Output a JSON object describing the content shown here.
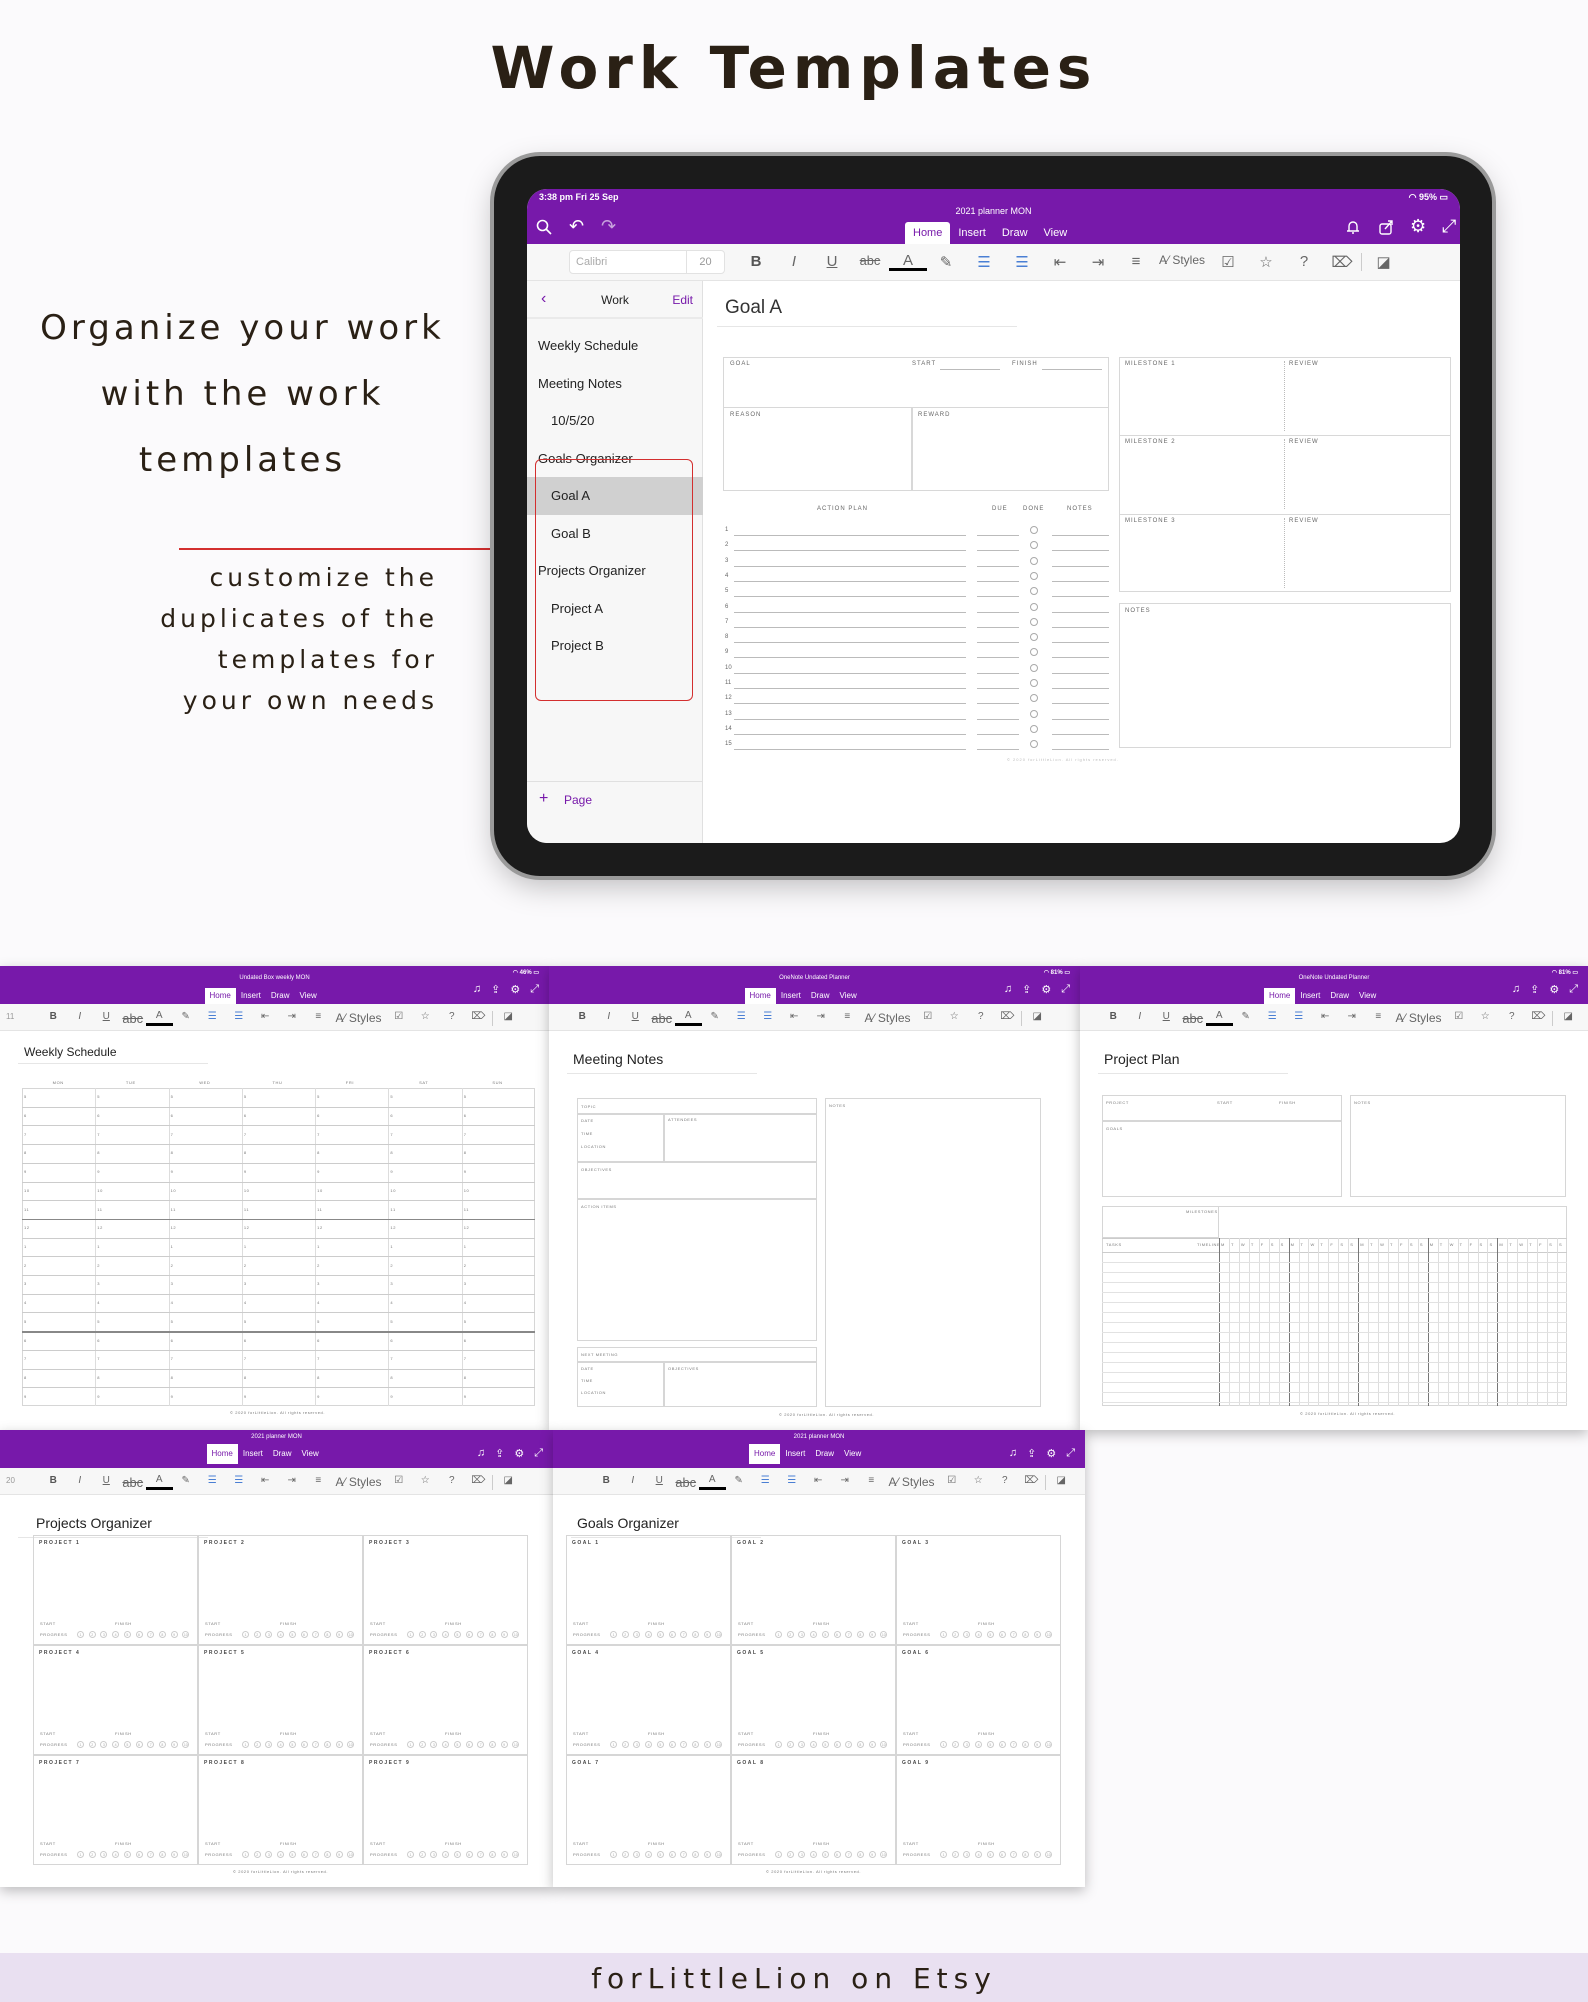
{
  "header": {
    "title": "Work Templates"
  },
  "tagline": {
    "lines": [
      "Organize your work",
      "with the work",
      "templates"
    ]
  },
  "note": {
    "lines": [
      "customize the",
      "duplicates of the",
      "templates for",
      "your own needs"
    ]
  },
  "footer": {
    "text": "forLittleLion on Etsy"
  },
  "colors": {
    "onenote_purple": "#7719aa",
    "highlight_red": "#d32f2f",
    "title_brown": "#2a2015",
    "footer_band": "#e9e0f1"
  },
  "toolbar_icons": [
    "bold",
    "italic",
    "underline",
    "strikethrough",
    "font-color",
    "highlighter",
    "bullets",
    "numbering",
    "outdent",
    "indent",
    "align",
    "styles",
    "checkbox",
    "star",
    "question",
    "tag",
    "sticky-note"
  ],
  "toolbar_glyphs": {
    "bold": "B",
    "italic": "I",
    "underline": "U",
    "strike": "abc",
    "font_color": "A",
    "styles": "Styles"
  },
  "tablet": {
    "status": {
      "time": "3:38 pm  Fri 25 Sep",
      "battery": "95%"
    },
    "notebook_title": "2021 planner MON",
    "tabs": [
      "Home",
      "Insert",
      "Draw",
      "View"
    ],
    "active_tab": "Home",
    "toolbar": {
      "font": "Calibri",
      "size": "20"
    },
    "sidebar": {
      "section": "Work",
      "edit": "Edit",
      "pages": [
        {
          "label": "Weekly Schedule",
          "sub": false,
          "selected": false
        },
        {
          "label": "Meeting Notes",
          "sub": false,
          "selected": false
        },
        {
          "label": "10/5/20",
          "sub": true,
          "selected": false
        },
        {
          "label": "Goals Organizer",
          "sub": false,
          "selected": false
        },
        {
          "label": "Goal A",
          "sub": true,
          "selected": true
        },
        {
          "label": "Goal B",
          "sub": true,
          "selected": false
        },
        {
          "label": "Projects Organizer",
          "sub": false,
          "selected": false
        },
        {
          "label": "Project A",
          "sub": true,
          "selected": false
        },
        {
          "label": "Project B",
          "sub": true,
          "selected": false
        }
      ],
      "add_page": "Page"
    },
    "page": {
      "title": "Goal A",
      "goal": "GOAL",
      "start": "START",
      "finish": "FINISH",
      "reason": "REASON",
      "reward": "REWARD",
      "action_plan": "ACTION PLAN",
      "due": "DUE",
      "done": "DONE",
      "notes": "NOTES",
      "rows": [
        "1",
        "2",
        "3",
        "4",
        "5",
        "6",
        "7",
        "8",
        "9",
        "10",
        "11",
        "12",
        "13",
        "14",
        "15"
      ],
      "milestones": [
        "MILESTONE 1",
        "MILESTONE 2",
        "MILESTONE 3"
      ],
      "review": "REVIEW",
      "notes_box": "NOTES",
      "copyright": "© 2020 forLittleLion. All rights reserved."
    }
  },
  "thumbnails": [
    {
      "type": "weekly",
      "notebook": "Undated Box weekly MON",
      "battery": "46%",
      "size": "11",
      "title": "Weekly Schedule",
      "days": [
        "MON",
        "TUE",
        "WED",
        "THU",
        "FRI",
        "SAT",
        "SUN"
      ],
      "hours": [
        "5",
        "6",
        "7",
        "8",
        "9",
        "10",
        "11",
        "12",
        "1",
        "2",
        "3",
        "4",
        "5",
        "6",
        "7",
        "8",
        "9"
      ]
    },
    {
      "type": "meeting",
      "notebook": "OneNote Undated Planner",
      "battery": "81%",
      "size": "",
      "title": "Meeting Notes",
      "labels": {
        "topic": "TOPIC",
        "date": "DATE",
        "time": "TIME",
        "location": "LOCATION",
        "attendees": "ATTENDEES",
        "objectives": "OBJECTIVES",
        "action_items": "ACTION ITEMS",
        "next_meeting": "NEXT MEETING",
        "notes": "NOTES"
      }
    },
    {
      "type": "project",
      "notebook": "OneNote Undated Planner",
      "battery": "81%",
      "size": "",
      "title": "Project Plan",
      "labels": {
        "project": "PROJECT",
        "start": "START",
        "finish": "FINISH",
        "notes": "NOTES",
        "goals": "GOALS",
        "milestones": "MILESTONES",
        "tasks": "TASKS",
        "timeline": "TIMELINE"
      },
      "weekdays": [
        "M",
        "T",
        "W",
        "T",
        "F",
        "S",
        "S"
      ],
      "weeks": 5
    },
    {
      "type": "organizer",
      "notebook": "2021 planner MON",
      "battery": "",
      "size": "20",
      "title": "Projects Organizer",
      "cards": [
        "PROJECT 1",
        "PROJECT 2",
        "PROJECT 3",
        "PROJECT 4",
        "PROJECT 5",
        "PROJECT 6",
        "PROJECT 7",
        "PROJECT 8",
        "PROJECT 9"
      ],
      "start": "START",
      "finish": "FINISH",
      "progress": "PROGRESS",
      "steps": [
        "1",
        "2",
        "3",
        "4",
        "5",
        "6",
        "7",
        "8",
        "9",
        "10"
      ]
    },
    {
      "type": "organizer",
      "notebook": "2021 planner MON",
      "battery": "",
      "size": "",
      "title": "Goals Organizer",
      "cards": [
        "GOAL 1",
        "GOAL 2",
        "GOAL 3",
        "GOAL 4",
        "GOAL 5",
        "GOAL 6",
        "GOAL 7",
        "GOAL 8",
        "GOAL 9"
      ],
      "start": "START",
      "finish": "FINISH",
      "progress": "PROGRESS",
      "steps": [
        "1",
        "2",
        "3",
        "4",
        "5",
        "6",
        "7",
        "8",
        "9",
        "10"
      ]
    }
  ],
  "tabs": [
    "Home",
    "Insert",
    "Draw",
    "View"
  ],
  "copyright": "© 2020 forLittleLion. All rights reserved."
}
